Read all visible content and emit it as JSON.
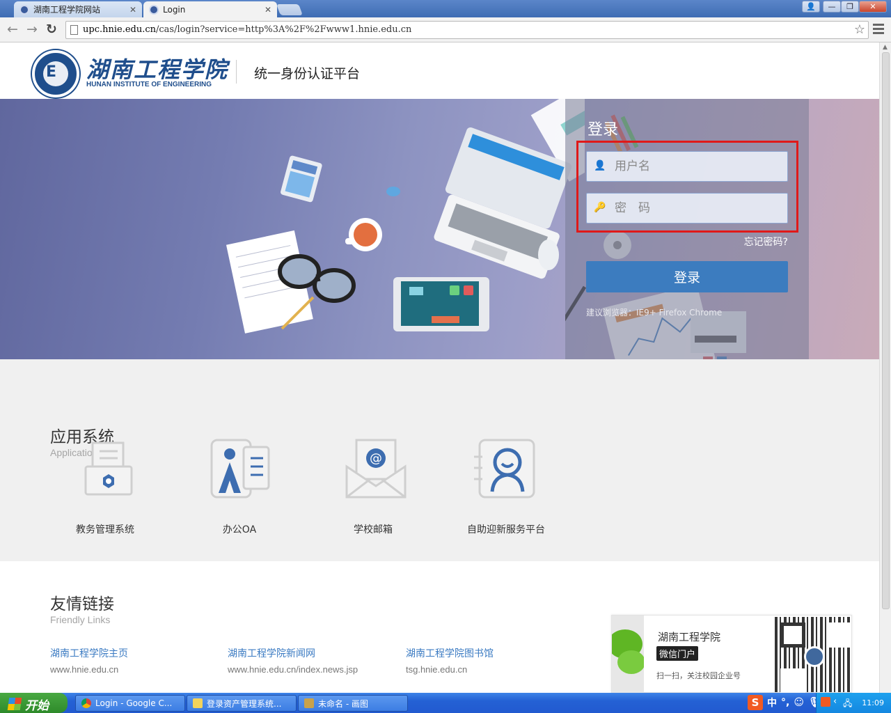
{
  "browser": {
    "tabs": [
      {
        "label": "湖南工程学院网站",
        "active": false
      },
      {
        "label": "Login",
        "active": true
      }
    ],
    "url_domain": "upc.hnie.edu.cn",
    "url_path": "/cas/login?service=http%3A%2F%2Fwww1.hnie.edu.cn",
    "nav_icons": [
      "back-arrow-icon",
      "forward-arrow-icon",
      "reload-icon"
    ]
  },
  "header": {
    "logo_text_cn": "湖南工程学院",
    "logo_text_en": "HUNAN INSTITUTE OF ENGINEERING",
    "platform_title": "统一身份认证平台"
  },
  "login": {
    "title": "登录",
    "username_placeholder": "用户名",
    "password_placeholder": "密　码",
    "forgot_password": "忘记密码?",
    "submit_label": "登录",
    "browser_tip": "建议浏览器：IE9+ Firefox Chrome"
  },
  "apps_section": {
    "title": "应用系统",
    "subtitle": "Applications",
    "items": [
      {
        "label": "教务管理系统",
        "icon": "file-cabinet-icon"
      },
      {
        "label": "办公OA",
        "icon": "id-card-icon"
      },
      {
        "label": "学校邮箱",
        "icon": "email-envelope-icon"
      },
      {
        "label": "自助迎新服务平台",
        "icon": "user-profile-icon"
      }
    ]
  },
  "links_section": {
    "title": "友情链接",
    "subtitle": "Friendly Links",
    "items": [
      {
        "title": "湖南工程学院主页",
        "url": "www.hnie.edu.cn"
      },
      {
        "title": "湖南工程学院新闻网",
        "url": "www.hnie.edu.cn/index.news.jsp"
      },
      {
        "title": "湖南工程学院图书馆",
        "url": "tsg.hnie.edu.cn"
      }
    ]
  },
  "wechat": {
    "name": "湖南工程学院",
    "badge": "微信门户",
    "tip": "扫一扫，关注校园企业号"
  },
  "taskbar": {
    "start_label": "开始",
    "tasks": [
      {
        "label": "Login - Google C...",
        "icon": "chrome-icon"
      },
      {
        "label": "登录资产管理系统...",
        "icon": "folder-icon"
      },
      {
        "label": "未命名 - 画图",
        "icon": "paint-icon"
      }
    ],
    "ime_label": "中",
    "clock": "11:09"
  },
  "colors": {
    "accent_blue": "#3c7cbf",
    "brand_navy": "#1f4e8c",
    "highlight_red": "#e01919",
    "link_blue": "#3a7ac2"
  }
}
